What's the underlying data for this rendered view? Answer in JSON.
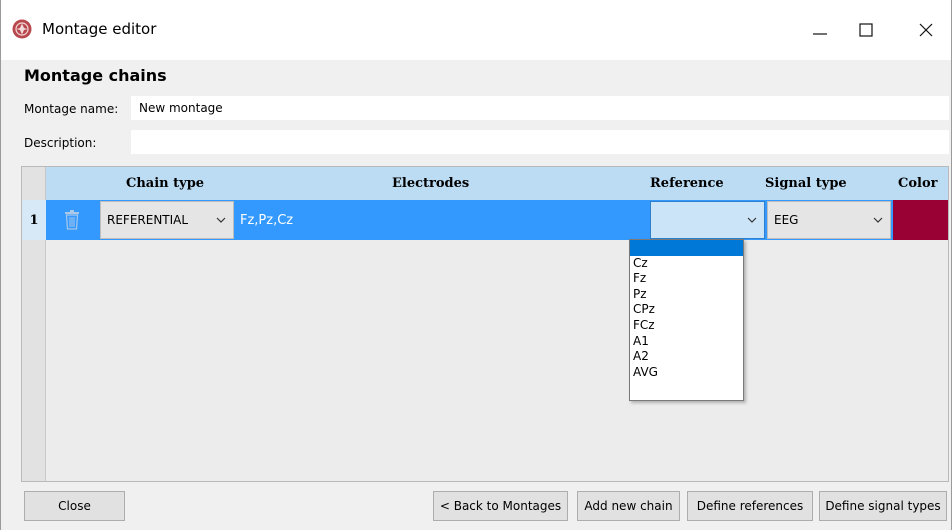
{
  "window": {
    "title": "Montage editor",
    "minimize_icon": "minimize-icon",
    "maximize_icon": "maximize-icon",
    "close_icon": "close-icon"
  },
  "heading": "Montage chains",
  "montage_name": {
    "label": "Montage name:",
    "value": "New montage"
  },
  "description": {
    "label": "Description:",
    "value": ""
  },
  "table": {
    "columns": [
      "Chain type",
      "Electrodes",
      "Reference",
      "Signal type",
      "Color"
    ],
    "rows": [
      {
        "number": "1",
        "chain_type": "REFERENTIAL",
        "electrodes": "Fz,Pz,Cz",
        "reference": "",
        "signal_type": "EEG",
        "color": "#990033"
      }
    ]
  },
  "reference_dropdown": {
    "options": [
      "",
      "Cz",
      "Fz",
      "Pz",
      "CPz",
      "FCz",
      "A1",
      "A2",
      "AVG"
    ],
    "highlighted": 0
  },
  "buttons": {
    "close": "Close",
    "back": "< Back to Montages",
    "add_chain": "Add new chain",
    "define_references": "Define references",
    "define_signal_types": "Define signal types"
  },
  "colors": {
    "selection": "#3399ff",
    "header": "#bcdcf4",
    "highlight": "#0078d7"
  }
}
